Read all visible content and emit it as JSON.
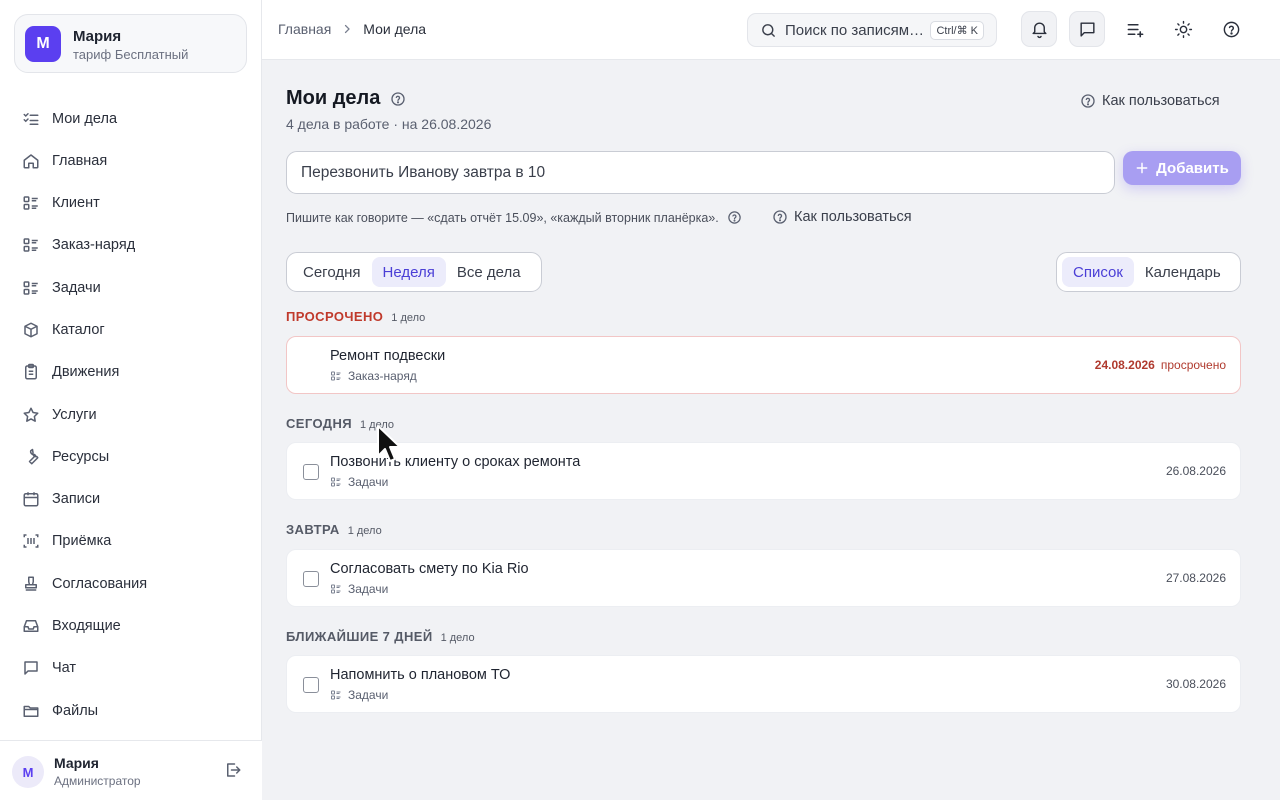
{
  "account": {
    "initial": "М",
    "name": "Мария",
    "plan": "тариф Бесплатный"
  },
  "nav": [
    {
      "label": "Мои дела",
      "icon": "checklist-icon",
      "active": true
    },
    {
      "label": "Главная",
      "icon": "home-icon"
    },
    {
      "label": "Клиент",
      "icon": "list-icon"
    },
    {
      "label": "Заказ-наряд",
      "icon": "list-icon"
    },
    {
      "label": "Задачи",
      "icon": "list-icon"
    },
    {
      "label": "Каталог",
      "icon": "box-icon"
    },
    {
      "label": "Движения",
      "icon": "clipboard-icon"
    },
    {
      "label": "Услуги",
      "icon": "star-icon"
    },
    {
      "label": "Ресурсы",
      "icon": "wrench-icon"
    },
    {
      "label": "Записи",
      "icon": "calendar-icon"
    },
    {
      "label": "Приёмка",
      "icon": "scan-icon"
    },
    {
      "label": "Согласования",
      "icon": "stamp-icon"
    },
    {
      "label": "Входящие",
      "icon": "inbox-icon"
    },
    {
      "label": "Чат",
      "icon": "chat-icon"
    },
    {
      "label": "Файлы",
      "icon": "folder-icon"
    }
  ],
  "user": {
    "initial": "М",
    "name": "Мария",
    "role": "Администратор"
  },
  "topbar": {
    "crumbs": [
      "Главная",
      "Мои дела"
    ],
    "search_placeholder": "Поиск по записям…",
    "search_shortcut": "Ctrl/⌘ K"
  },
  "page": {
    "title": "Мои дела",
    "subtitle": "4 дела в работе · на 26.08.2026",
    "howto": "Как пользоваться",
    "entry_value": "Перезвонить Иванову завтра в 10",
    "add_label": "Добавить",
    "hint": "Пишите как говорите — «сдать отчёт 15.09», «каждый вторник планёрка».",
    "howto_hint": "Как пользоваться",
    "range_tabs": [
      "Сегодня",
      "Неделя",
      "Все дела"
    ],
    "range_active": "Неделя",
    "view_tabs": [
      "Список",
      "Календарь"
    ],
    "view_active": "Список"
  },
  "groups": [
    {
      "title": "ПРОСРОЧЕНО",
      "count": "1 дело",
      "overdue": true,
      "tasks": [
        {
          "name": "Ремонт подвески",
          "type": "Заказ-наряд",
          "date": "24.08.2026",
          "status": "просрочено"
        }
      ]
    },
    {
      "title": "СЕГОДНЯ",
      "count": "1 дело",
      "tasks": [
        {
          "name": "Позвонить клиенту о сроках ремонта",
          "type": "Задачи",
          "date": "26.08.2026"
        }
      ]
    },
    {
      "title": "ЗАВТРА",
      "count": "1 дело",
      "tasks": [
        {
          "name": "Согласовать смету по Kia Rio",
          "type": "Задачи",
          "date": "27.08.2026"
        }
      ]
    },
    {
      "title": "БЛИЖАЙШИЕ 7 ДНЕЙ",
      "count": "1 дело",
      "tasks": [
        {
          "name": "Напомнить о плановом ТО",
          "type": "Задачи",
          "date": "30.08.2026"
        }
      ]
    }
  ],
  "colors": {
    "accent": "#5b3ff0",
    "active_bg": "#ededfd",
    "overdue": "#c0392b",
    "add_button": "#a89ef2"
  }
}
